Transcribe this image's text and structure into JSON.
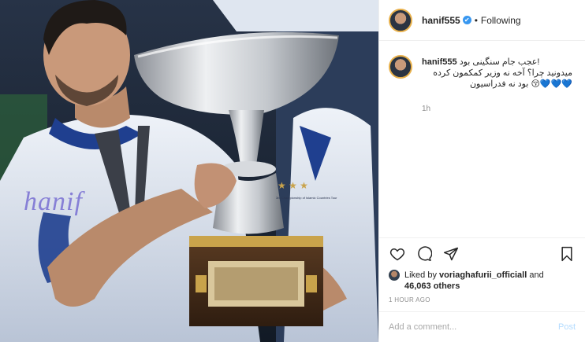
{
  "photo": {
    "watermark": "hanif",
    "banner_text": "3rd Championship of Islamic Countries Tour"
  },
  "header": {
    "username": "hanif555",
    "verified": "✔",
    "separator": "•",
    "follow_status": "Following"
  },
  "caption": {
    "username": "hanif555",
    "line1": "عجب جام سنگینی بود!",
    "line2": "میدونید چرا؟ آخه نه وزیر کمکمون کرده",
    "line3": "بود نه فدراسیون",
    "hearts": "💙💙💙",
    "emoji": "😚",
    "time": "1h"
  },
  "actions": {
    "like_icon": "heart-icon",
    "comment_icon": "comment-icon",
    "share_icon": "share-icon",
    "save_icon": "bookmark-icon"
  },
  "likes": {
    "prefix": "Liked by ",
    "user": "voriaghafurii_officiall",
    "middle": " and",
    "count": "46,063 others"
  },
  "timestamp": "1 HOUR AGO",
  "comment": {
    "placeholder": "Add a comment...",
    "post_label": "Post"
  },
  "colors": {
    "accent": "#3897f0",
    "post_disabled": "#b3dbff",
    "muted": "#8e8e8e",
    "heart_blue": "#2aa9c6"
  }
}
